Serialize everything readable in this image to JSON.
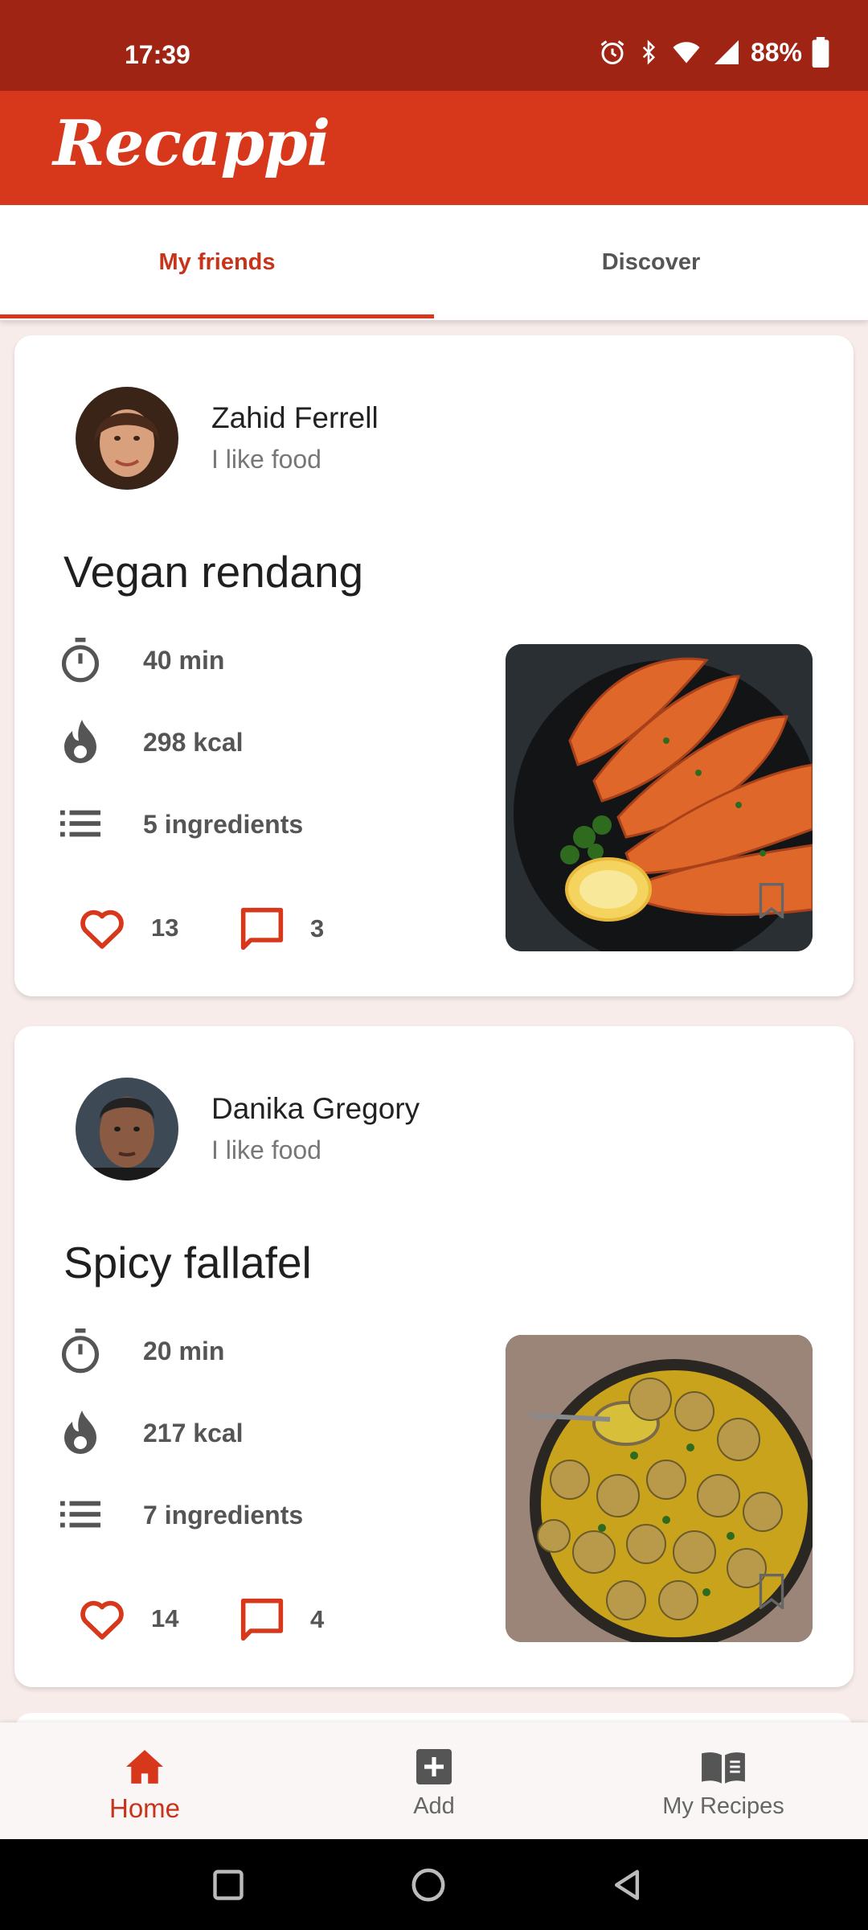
{
  "status_bar": {
    "time": "17:39",
    "battery": "88%"
  },
  "app": {
    "title": "Recappi"
  },
  "tabs": [
    {
      "label": "My friends"
    },
    {
      "label": "Discover"
    }
  ],
  "cards": [
    {
      "author": {
        "name": "Zahid Ferrell",
        "bio": "I like food"
      },
      "title": "Vegan rendang",
      "time": "40 min",
      "calories": "298 kcal",
      "ingredients": "5 ingredients",
      "likes": "13",
      "comments": "3"
    },
    {
      "author": {
        "name": "Danika Gregory",
        "bio": "I like food"
      },
      "title": "Spicy fallafel",
      "time": "20 min",
      "calories": "217 kcal",
      "ingredients": "7 ingredients",
      "likes": "14",
      "comments": "4"
    }
  ],
  "bottom_nav": [
    {
      "label": "Home"
    },
    {
      "label": "Add"
    },
    {
      "label": "My Recipes"
    }
  ],
  "colors": {
    "primary": "#d7381c",
    "status_bar": "#9f2413",
    "accent_text": "#c8341a"
  },
  "icons": [
    "alarm-icon",
    "bluetooth-icon",
    "wifi-icon",
    "signal-icon",
    "battery-icon",
    "timer-icon",
    "flame-icon",
    "list-icon",
    "heart-icon",
    "comment-icon",
    "bookmark-icon",
    "home-icon",
    "add-box-icon",
    "book-icon"
  ]
}
